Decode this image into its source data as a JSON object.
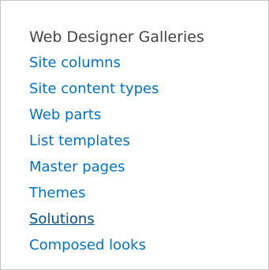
{
  "section": {
    "title": "Web Designer Galleries",
    "links": [
      {
        "label": "Site columns",
        "active": false
      },
      {
        "label": "Site content types",
        "active": false
      },
      {
        "label": "Web parts",
        "active": false
      },
      {
        "label": "List templates",
        "active": false
      },
      {
        "label": "Master pages",
        "active": false
      },
      {
        "label": "Themes",
        "active": false
      },
      {
        "label": "Solutions",
        "active": true
      },
      {
        "label": "Composed looks",
        "active": false
      }
    ]
  },
  "colors": {
    "link": "#0072c6",
    "link_active": "#004e8c",
    "title": "#444444",
    "border": "#c6c6c6"
  }
}
